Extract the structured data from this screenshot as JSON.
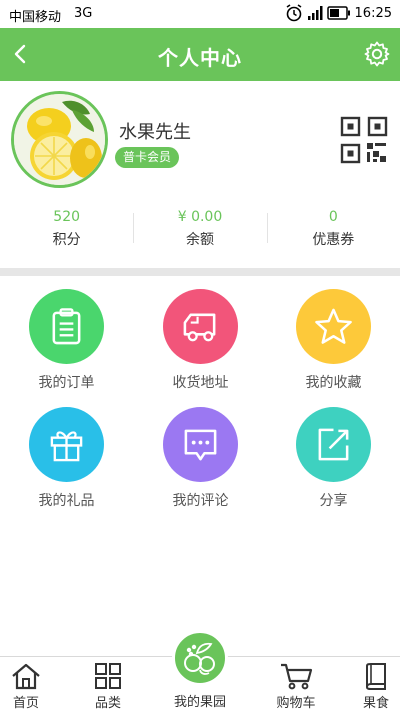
{
  "status_bar": {
    "carrier": "中国移动",
    "network": "3G",
    "time": "16:25"
  },
  "header": {
    "title": "个人中心",
    "back_icon": "chevron-left-icon",
    "settings_icon": "gear-icon"
  },
  "profile": {
    "name": "水果先生",
    "member_level": "普卡会员",
    "avatar_icon": "lemon-avatar",
    "qr_icon": "qr-code-icon"
  },
  "stats": [
    {
      "value": "520",
      "label": "积分"
    },
    {
      "value": "¥ 0.00",
      "label": "余额"
    },
    {
      "value": "0",
      "label": "优惠券"
    }
  ],
  "grid": [
    {
      "label": "我的订单",
      "icon": "clipboard-icon",
      "color": "#4ad66d"
    },
    {
      "label": "收货地址",
      "icon": "truck-icon",
      "color": "#f2557a"
    },
    {
      "label": "我的收藏",
      "icon": "star-icon",
      "color": "#fdc93a"
    },
    {
      "label": "我的礼品",
      "icon": "gift-icon",
      "color": "#29bfe8"
    },
    {
      "label": "我的评论",
      "icon": "comment-icon",
      "color": "#9b78f2"
    },
    {
      "label": "分享",
      "icon": "share-icon",
      "color": "#3ed1c0"
    }
  ],
  "bottom_nav": [
    {
      "label": "首页",
      "icon": "home-icon"
    },
    {
      "label": "品类",
      "icon": "grid-icon"
    },
    {
      "label": "我的果园",
      "icon": "fruit-basket-icon"
    },
    {
      "label": "购物车",
      "icon": "cart-icon"
    },
    {
      "label": "果食",
      "icon": "book-icon"
    }
  ],
  "colors": {
    "brand_green": "#6ac45a"
  }
}
